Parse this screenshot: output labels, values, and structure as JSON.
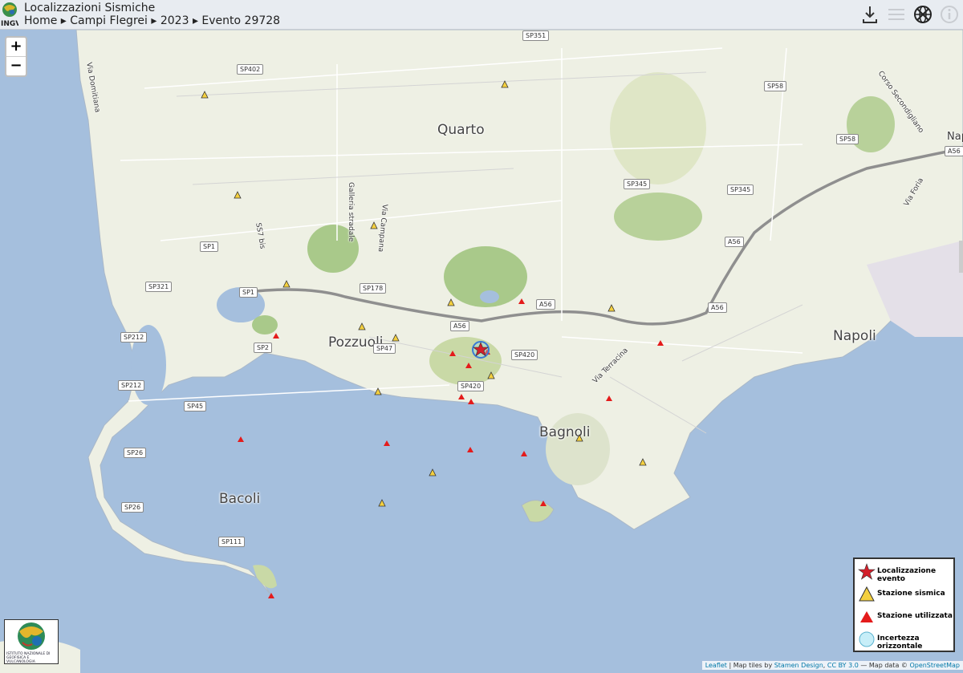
{
  "header": {
    "title": "Localizzazioni Sismiche",
    "breadcrumb": {
      "home": "Home",
      "separator": "▸",
      "area": "Campi Flegrei",
      "year": "2023",
      "event": "Evento 29728"
    },
    "logo_text": "INGV"
  },
  "zoom": {
    "in": "+",
    "out": "−"
  },
  "places": {
    "quarto": "Quarto",
    "pozzuoli": "Pozzuoli",
    "napoli": "Napoli",
    "napoli_edge": "Nap",
    "bagnoli": "Bagnoli",
    "bacoli": "Bacoli",
    "via_domitiana": "Via Domitiana",
    "galleria": "Galleria stradale",
    "via_campana": "Via Campana",
    "via_terracina": "Via Terracina",
    "via_foria": "Via Foria",
    "corso": "Corso Secondigliano",
    "ss7": "SS7 bis"
  },
  "road_shields": {
    "sp351": "SP351",
    "sp402": "SP402",
    "sp58a": "SP58",
    "sp58b": "SP58",
    "a56a": "A56",
    "sp345a": "SP345",
    "sp345b": "SP345",
    "a56b": "A56",
    "sp1a": "SP1",
    "sp1b": "SP1",
    "sp321": "SP321",
    "sp178": "SP178",
    "a56c": "A56",
    "a56d": "A56",
    "a56e": "A56",
    "sp212a": "SP212",
    "sp2": "SP2",
    "sp47": "SP47",
    "sp420a": "SP420",
    "sp212b": "SP212",
    "sp420b": "SP420",
    "sp45": "SP45",
    "sp26a": "SP26",
    "sp26b": "SP26",
    "sp111": "SP111"
  },
  "legend": {
    "event": "Localizzazione evento",
    "station": "Stazione sismica",
    "used": "Stazione utilizzata",
    "uncertainty": "Incertezza orizzontale"
  },
  "ingv_logo_text": "ISTITUTO NAZIONALE DI GEOFISICA E VULCANOLOGIA",
  "attribution": {
    "leaflet": "Leaflet",
    "sep": " | Map tiles by ",
    "stamen": "Stamen Design",
    "comma": ", ",
    "ccby": "CC BY 3.0",
    "dash": " — Map data © ",
    "osm": "OpenStreetMap"
  },
  "colors": {
    "sea": "#a5bfdd",
    "land": "#eef0e4",
    "park": "#b8d19a",
    "event_star": "#d31f2a",
    "station_fill": "#f4d03f",
    "used_fill": "#e41b1b",
    "uncertainty": "#9fdcf0"
  },
  "icons": [
    "download-icon",
    "menu-icon",
    "no-globe-icon",
    "info-icon"
  ]
}
